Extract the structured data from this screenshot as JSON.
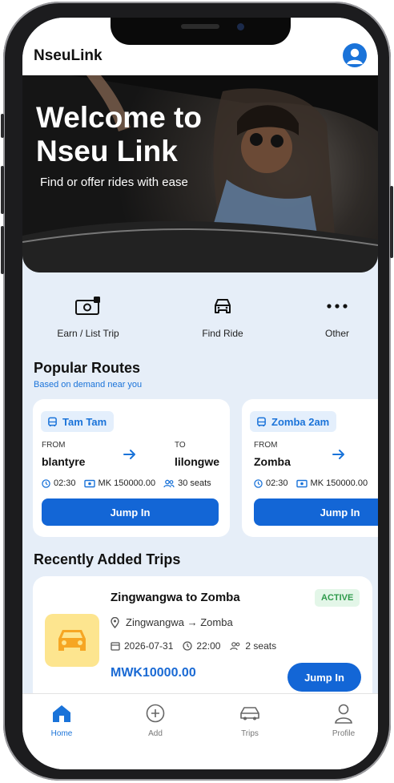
{
  "app": {
    "brand": "NseuLink"
  },
  "hero": {
    "title": "Welcome to Nseu Link",
    "subtitle": "Find or offer rides with ease"
  },
  "actions": [
    {
      "label": "Earn / List Trip",
      "icon": "money-icon"
    },
    {
      "label": "Find Ride",
      "icon": "car-icon"
    },
    {
      "label": "Other",
      "icon": "more-icon"
    }
  ],
  "popular": {
    "title": "Popular Routes",
    "subtitle": "Based on demand near you",
    "routes": [
      {
        "name": "Tam Tam",
        "from_label": "FROM",
        "from": "blantyre",
        "to_label": "TO",
        "to": "lilongwe",
        "time": "02:30",
        "price": "MK 150000.00",
        "seats": "30 seats",
        "cta": "Jump In"
      },
      {
        "name": "Zomba 2am",
        "from_label": "FROM",
        "from": "Zomba",
        "time": "02:30",
        "price": "MK 150000.00",
        "cta": "Jump In"
      }
    ]
  },
  "recent": {
    "title": "Recently Added Trips",
    "trips": [
      {
        "title": "Zingwangwa to Zomba",
        "status": "ACTIVE",
        "route": "Zingwangwa → Zomba",
        "date": "2026-07-31",
        "time": "22:00",
        "seats": "2 seats",
        "price": "MWK10000.00",
        "cta": "Jump In"
      }
    ]
  },
  "tabs": [
    {
      "label": "Home",
      "icon": "home-icon",
      "active": true
    },
    {
      "label": "Add",
      "icon": "add-circle-icon"
    },
    {
      "label": "Trips",
      "icon": "car-outline-icon"
    },
    {
      "label": "Profile",
      "icon": "person-icon"
    }
  ],
  "colors": {
    "primary": "#1366d6",
    "background": "#e6eef8",
    "active_badge": "#2e9a4b",
    "thumb": "#fde58f"
  }
}
